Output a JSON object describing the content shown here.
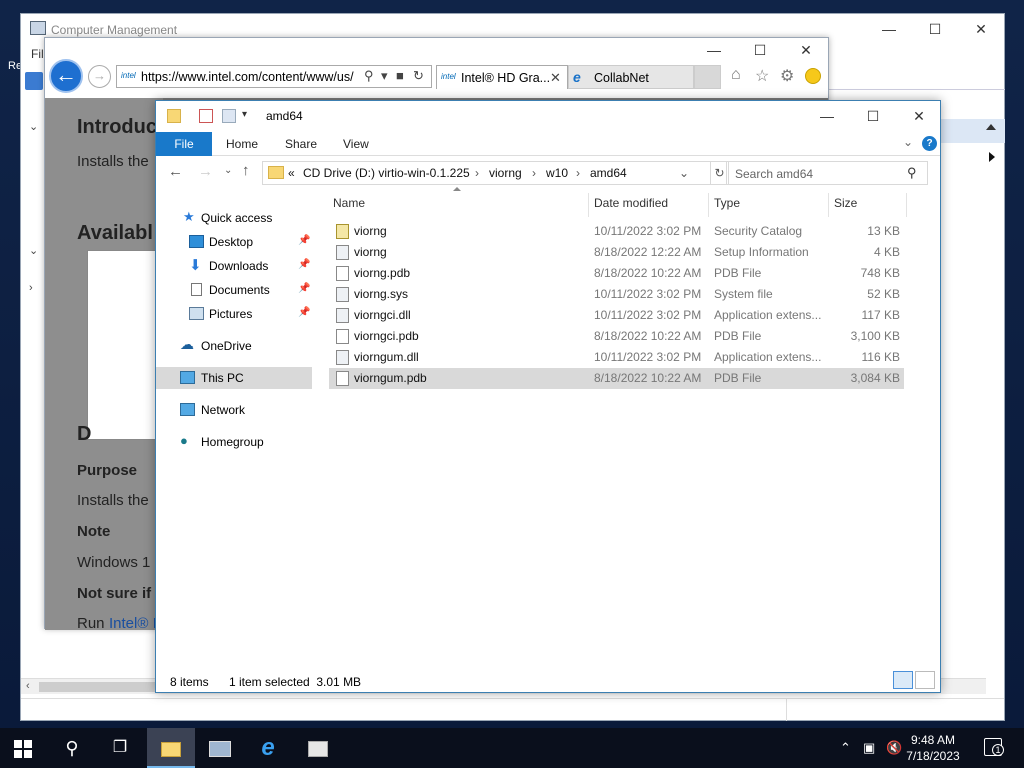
{
  "computer_management": {
    "title": "Computer Management",
    "menu_partial": "Fil"
  },
  "desktop_partial_label": "Re",
  "ie": {
    "url": "https://www.intel.com/content/www/us/",
    "tabs": [
      {
        "label": "Intel® HD Gra...",
        "icon": "intel-logo"
      },
      {
        "label": "CollabNet",
        "icon": "ie-icon"
      }
    ],
    "logo_text": "intel",
    "page_fragments": {
      "introduction": "Introduc",
      "installs1": "Installs the",
      "available": "Availabl",
      "detail_letter": "D",
      "purpose": "Purpose",
      "installs2": "Installs the",
      "note": "Note",
      "windows": "Windows 1",
      "not_sure": "Not sure if",
      "run": "Run",
      "run_link": "Intel® I"
    }
  },
  "explorer": {
    "title": "amd64",
    "ribbon_tabs": [
      "File",
      "Home",
      "Share",
      "View"
    ],
    "breadcrumb": [
      "CD Drive (D:) virtio-win-0.1.225",
      "viorng",
      "w10",
      "amd64"
    ],
    "breadcrumb_overflow": "«",
    "search_placeholder": "Search amd64",
    "nav": {
      "quick_access": "Quick access",
      "desktop": "Desktop",
      "downloads": "Downloads",
      "documents": "Documents",
      "pictures": "Pictures",
      "onedrive": "OneDrive",
      "this_pc": "This PC",
      "network": "Network",
      "homegroup": "Homegroup"
    },
    "columns": {
      "name": "Name",
      "date": "Date modified",
      "type": "Type",
      "size": "Size"
    },
    "files": [
      {
        "name": "viorng",
        "date": "10/11/2022 3:02 PM",
        "type": "Security Catalog",
        "size": "13 KB",
        "icon": "catalog-icon"
      },
      {
        "name": "viorng",
        "date": "8/18/2022 12:22 AM",
        "type": "Setup Information",
        "size": "4 KB",
        "icon": "setup-info-icon"
      },
      {
        "name": "viorng.pdb",
        "date": "8/18/2022 10:22 AM",
        "type": "PDB File",
        "size": "748 KB",
        "icon": "file-icon"
      },
      {
        "name": "viorng.sys",
        "date": "10/11/2022 3:02 PM",
        "type": "System file",
        "size": "52 KB",
        "icon": "system-file-icon"
      },
      {
        "name": "viorngci.dll",
        "date": "10/11/2022 3:02 PM",
        "type": "Application extens...",
        "size": "117 KB",
        "icon": "dll-icon"
      },
      {
        "name": "viorngci.pdb",
        "date": "8/18/2022 10:22 AM",
        "type": "PDB File",
        "size": "3,100 KB",
        "icon": "file-icon"
      },
      {
        "name": "viorngum.dll",
        "date": "10/11/2022 3:02 PM",
        "type": "Application extens...",
        "size": "116 KB",
        "icon": "dll-icon"
      },
      {
        "name": "viorngum.pdb",
        "date": "8/18/2022 10:22 AM",
        "type": "PDB File",
        "size": "3,084 KB",
        "icon": "file-icon",
        "selected": true
      }
    ],
    "status": {
      "count": "8 items",
      "selection": "1 item selected  3.01 MB"
    }
  },
  "taskbar": {
    "time": "9:48 AM",
    "date": "7/18/2023",
    "notification_count": "1"
  }
}
